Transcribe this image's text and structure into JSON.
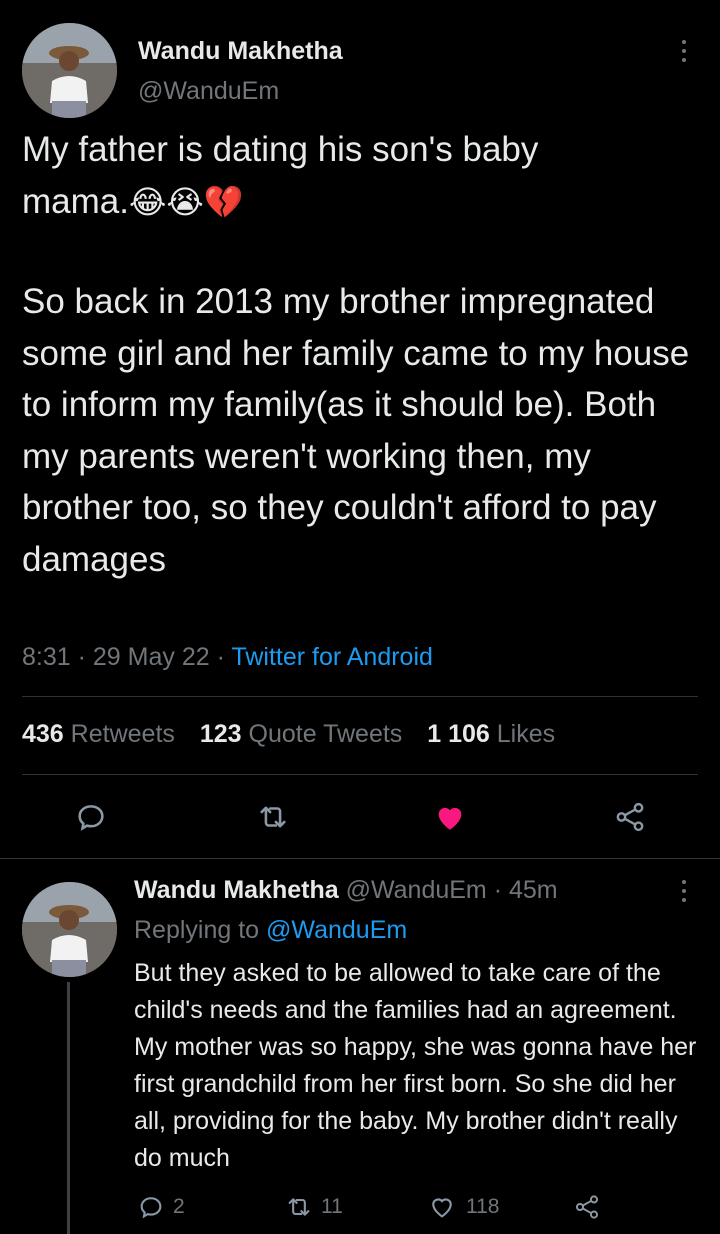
{
  "tweet": {
    "author_name": "Wandu Makhetha",
    "author_handle": "@WanduEm",
    "text_line1": "My father is dating his son's baby",
    "text_line2": "mama.",
    "emojis": [
      "😂",
      "😭",
      "💔"
    ],
    "body": "So back in 2013 my brother impregnated some girl and her family came to my house to inform my family(as it should be). Both my parents weren't working then, my brother too, so they couldn't afford to pay damages",
    "time": "8:31",
    "date": "29 May 22",
    "source": "Twitter for Android",
    "stats": {
      "retweets_count": "436",
      "retweets_label": "Retweets",
      "quotes_count": "123",
      "quotes_label": "Quote Tweets",
      "likes_count": "1 106",
      "likes_label": "Likes"
    },
    "colors": {
      "like": "#f91880",
      "link": "#1d9bf0"
    }
  },
  "reply": {
    "author_name": "Wandu Makhetha",
    "author_handle": "@WanduEm",
    "time_ago": "45m",
    "replying_label": "Replying to",
    "replying_to": "@WanduEm",
    "text": "But they asked to be allowed to take care of the child's needs and the families had an agreement. My mother was so happy, she was gonna have her first grandchild from her first born. So she did her all, providing for the baby. My brother didn't really do much",
    "replies": "2",
    "retweets": "11",
    "likes": "118"
  }
}
